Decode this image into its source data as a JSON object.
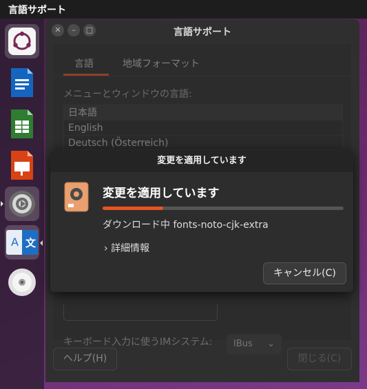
{
  "topbar": {
    "app_title": "言語サポート"
  },
  "dock": {
    "items": [
      {
        "name": "ubuntu-software",
        "icon": "ubuntu-logo-icon"
      },
      {
        "name": "writer",
        "icon": "libreoffice-writer-icon"
      },
      {
        "name": "calc",
        "icon": "libreoffice-calc-icon"
      },
      {
        "name": "impress",
        "icon": "libreoffice-impress-icon"
      },
      {
        "name": "settings",
        "icon": "gear-icon"
      },
      {
        "name": "language-support",
        "icon": "language-icon",
        "glyph_a": "A",
        "glyph_b": "文"
      },
      {
        "name": "disc",
        "icon": "disc-icon"
      }
    ]
  },
  "window": {
    "title": "言語サポート",
    "tabs": [
      {
        "label": "言語",
        "active": true
      },
      {
        "label": "地域フォーマット",
        "active": false
      }
    ],
    "section_label": "メニューとウィンドウの言語:",
    "languages": [
      "日本語",
      "English",
      "Deutsch (Österreich)"
    ],
    "im_label": "キーボード入力に使うIMシステム:",
    "im_value": "IBus",
    "help_button": "ヘルプ(H)",
    "close_button": "閉じる(C)"
  },
  "dialog": {
    "header": "変更を適用しています",
    "title": "変更を適用しています",
    "progress": 0.25,
    "status": "ダウンロード中 fonts-noto-cjk-extra",
    "details_label": "詳細情報",
    "cancel_button": "キャンセル(C)"
  },
  "colors": {
    "accent": "#e95420",
    "window_bg": "#2f2f2f",
    "dialog_bg": "#2d2d2d"
  }
}
